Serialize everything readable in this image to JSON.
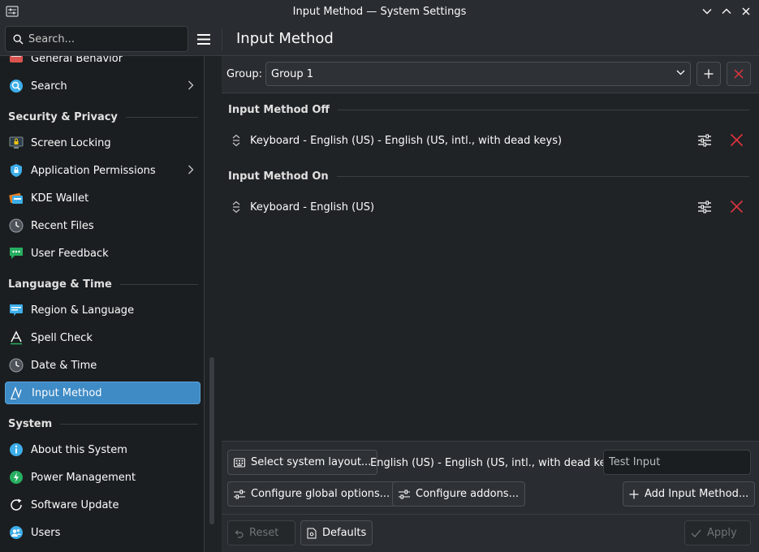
{
  "window": {
    "title": "Input Method — System Settings"
  },
  "header": {
    "search_placeholder": "Search...",
    "page_title": "Input Method"
  },
  "sidebar": {
    "items": [
      {
        "label": "General Behavior",
        "icon": "general-behavior-icon"
      },
      {
        "label": "Search",
        "icon": "search-settings-icon"
      },
      {
        "label": "Screen Locking",
        "icon": "screen-lock-icon"
      },
      {
        "label": "Application Permissions",
        "icon": "shield-icon"
      },
      {
        "label": "KDE Wallet",
        "icon": "wallet-icon"
      },
      {
        "label": "Recent Files",
        "icon": "clock-icon"
      },
      {
        "label": "User Feedback",
        "icon": "feedback-icon"
      },
      {
        "label": "Region & Language",
        "icon": "region-icon"
      },
      {
        "label": "Spell Check",
        "icon": "spell-check-icon"
      },
      {
        "label": "Date & Time",
        "icon": "clock-icon"
      },
      {
        "label": "Input Method",
        "icon": "input-method-icon"
      },
      {
        "label": "About this System",
        "icon": "info-icon"
      },
      {
        "label": "Power Management",
        "icon": "power-icon"
      },
      {
        "label": "Software Update",
        "icon": "update-icon"
      },
      {
        "label": "Users",
        "icon": "users-icon"
      }
    ],
    "sections": {
      "security": "Security & Privacy",
      "language": "Language & Time",
      "system": "System"
    },
    "active": "Input Method"
  },
  "main": {
    "group_label": "Group:",
    "group_value": "Group 1",
    "sections": [
      {
        "title": "Input Method Off",
        "items": [
          "Keyboard - English (US) - English (US, intl., with dead keys)"
        ]
      },
      {
        "title": "Input Method On",
        "items": [
          "Keyboard - English (US)"
        ]
      }
    ],
    "select_layout_label": "Select system layout...",
    "current_layout": "English (US) - English (US, intl., with dead keys)",
    "test_input_placeholder": "Test Input",
    "configure_global_label": "Configure global options...",
    "configure_addons_label": "Configure addons...",
    "add_input_method_label": "Add Input Method..."
  },
  "footer": {
    "reset_label": "Reset",
    "defaults_label": "Defaults",
    "apply_label": "Apply"
  },
  "colors": {
    "accent": "#3e8bc6",
    "remove": "#e0343f",
    "background": "#202326",
    "sidebar": "#1b1e20"
  }
}
